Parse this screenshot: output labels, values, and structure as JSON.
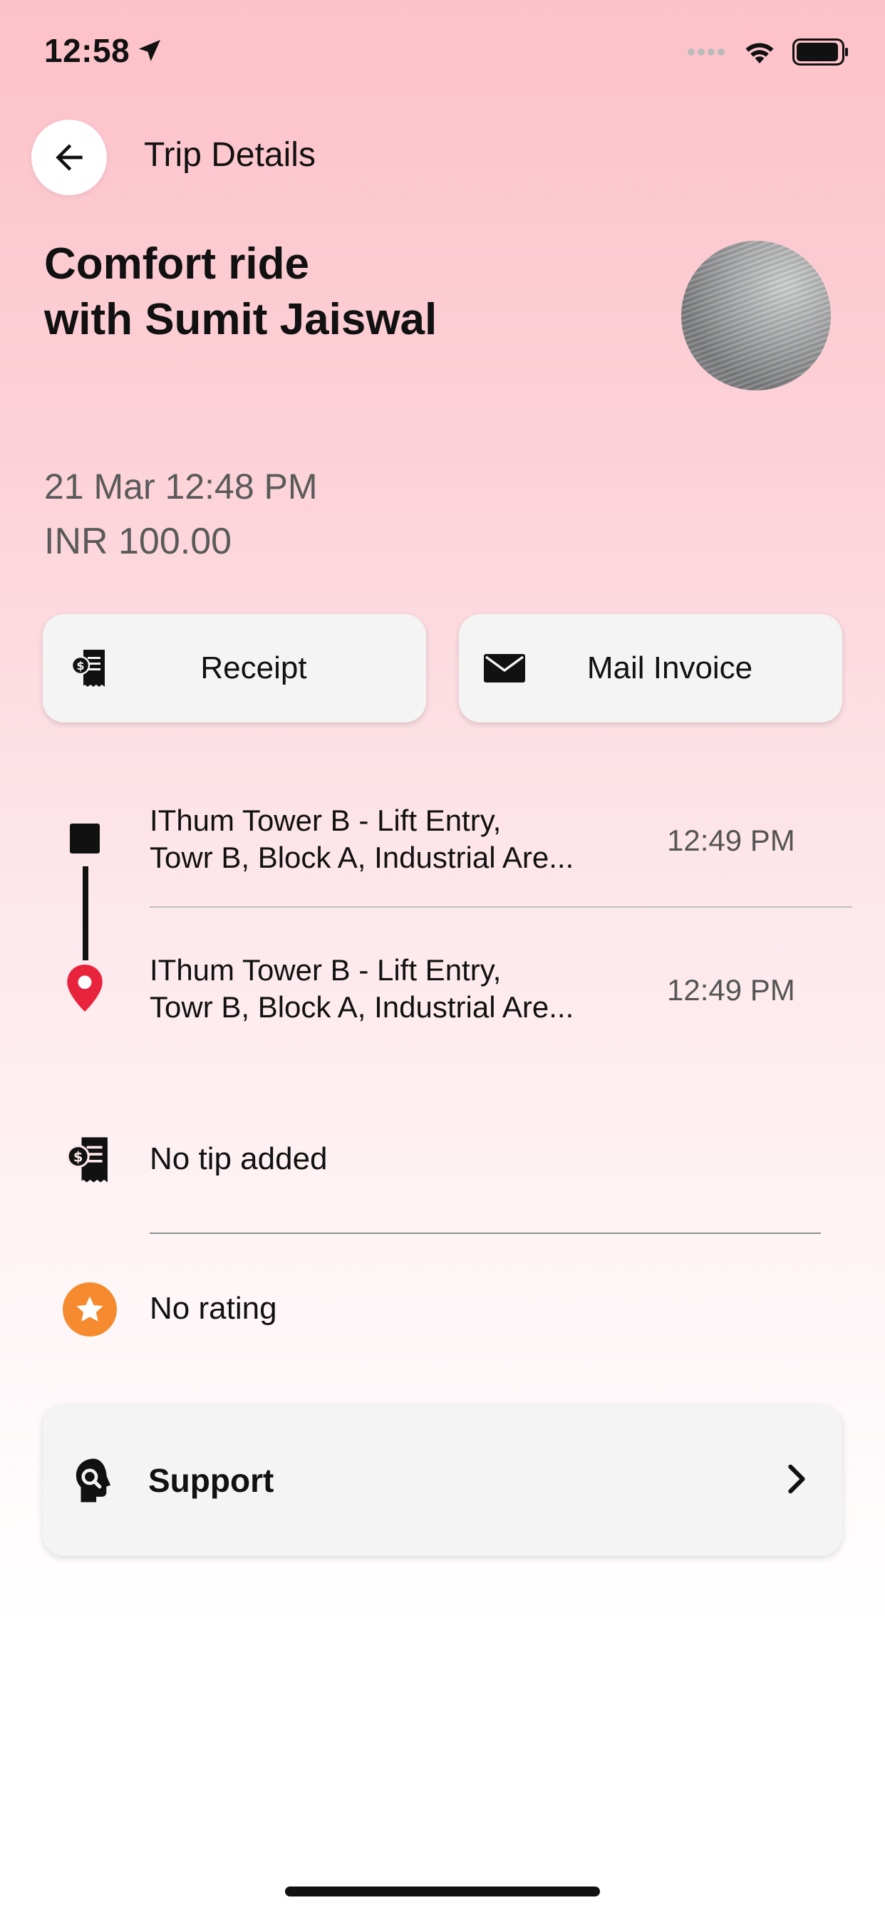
{
  "status_bar": {
    "time": "12:58",
    "location_icon": "location-arrow-icon",
    "signal_icon": "signal-dots-icon",
    "wifi_icon": "wifi-icon",
    "battery_icon": "battery-icon"
  },
  "header": {
    "back_icon": "arrow-left-icon",
    "title": "Trip Details"
  },
  "ride": {
    "title_line1": "Comfort ride",
    "title_line2": "with Sumit Jaiswal",
    "date": "21 Mar 12:48 PM",
    "fare": "INR 100.00"
  },
  "actions": [
    {
      "label": "Receipt",
      "icon": "receipt-icon"
    },
    {
      "label": "Mail Invoice",
      "icon": "envelope-icon"
    }
  ],
  "route": {
    "pickup": {
      "address_line1": "IThum Tower B - Lift Entry,",
      "address_line2": "Towr B, Block A, Industrial Are...",
      "time": "12:49 PM"
    },
    "dropoff": {
      "address_line1": "IThum Tower B - Lift Entry,",
      "address_line2": "Towr B, Block A, Industrial Are...",
      "time": "12:49 PM"
    }
  },
  "tip": {
    "text": "No tip added",
    "icon": "receipt-icon"
  },
  "rating": {
    "text": "No rating",
    "icon": "star-icon"
  },
  "support": {
    "label": "Support",
    "icon": "support-agent-icon",
    "chevron": "chevron-right-icon"
  },
  "colors": {
    "rating_orange": "#f58a2e",
    "dropoff_red": "#e8233c"
  }
}
